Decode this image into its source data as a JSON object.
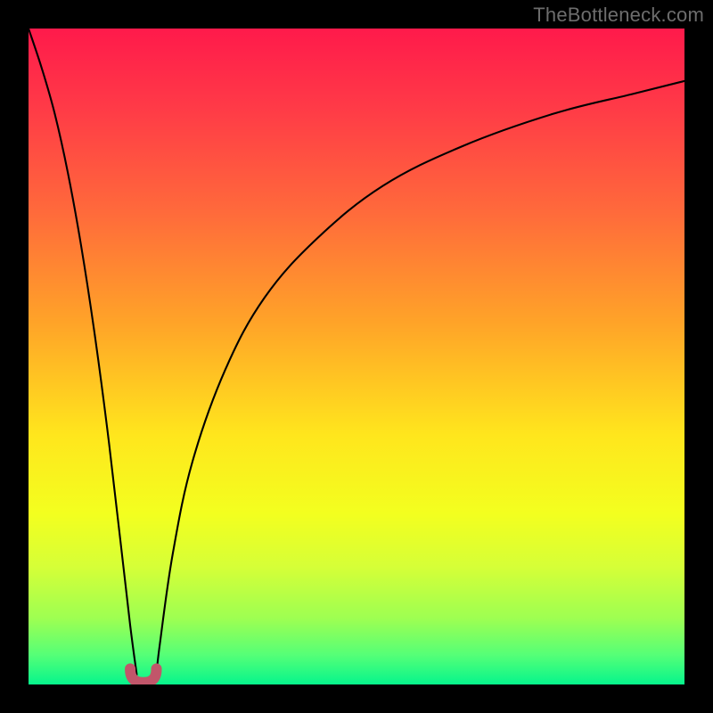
{
  "watermark": "TheBottleneck.com",
  "colors": {
    "frame": "#000000",
    "curve": "#000000",
    "marker": "#c1566a",
    "gradient_stops": [
      {
        "offset": 0.0,
        "color": "#ff1a4b"
      },
      {
        "offset": 0.12,
        "color": "#ff3a47"
      },
      {
        "offset": 0.28,
        "color": "#ff6a3b"
      },
      {
        "offset": 0.45,
        "color": "#ffa428"
      },
      {
        "offset": 0.62,
        "color": "#ffe61d"
      },
      {
        "offset": 0.74,
        "color": "#f3ff1f"
      },
      {
        "offset": 0.82,
        "color": "#d6ff37"
      },
      {
        "offset": 0.9,
        "color": "#9dff52"
      },
      {
        "offset": 0.955,
        "color": "#55ff77"
      },
      {
        "offset": 1.0,
        "color": "#06f58c"
      }
    ]
  },
  "chart_data": {
    "type": "line",
    "title": "",
    "xlabel": "",
    "ylabel": "",
    "xlim": [
      0,
      100
    ],
    "ylim": [
      0,
      100
    ],
    "series": [
      {
        "name": "left-branch",
        "x": [
          0,
          2,
          4,
          6,
          8,
          10,
          12,
          14,
          15.5,
          16.5
        ],
        "y": [
          100,
          94,
          87,
          78,
          67,
          54,
          39,
          22,
          9,
          1.5
        ]
      },
      {
        "name": "right-branch",
        "x": [
          19.5,
          20,
          22,
          25,
          30,
          36,
          44,
          54,
          66,
          80,
          92,
          100
        ],
        "y": [
          1.5,
          6,
          20,
          34,
          48,
          59,
          68,
          76,
          82,
          87,
          90,
          92
        ]
      }
    ],
    "marker": {
      "name": "u-shape",
      "x_range": [
        15.5,
        19.5
      ],
      "y_min": 0.3,
      "y_peak": 2.4
    }
  }
}
